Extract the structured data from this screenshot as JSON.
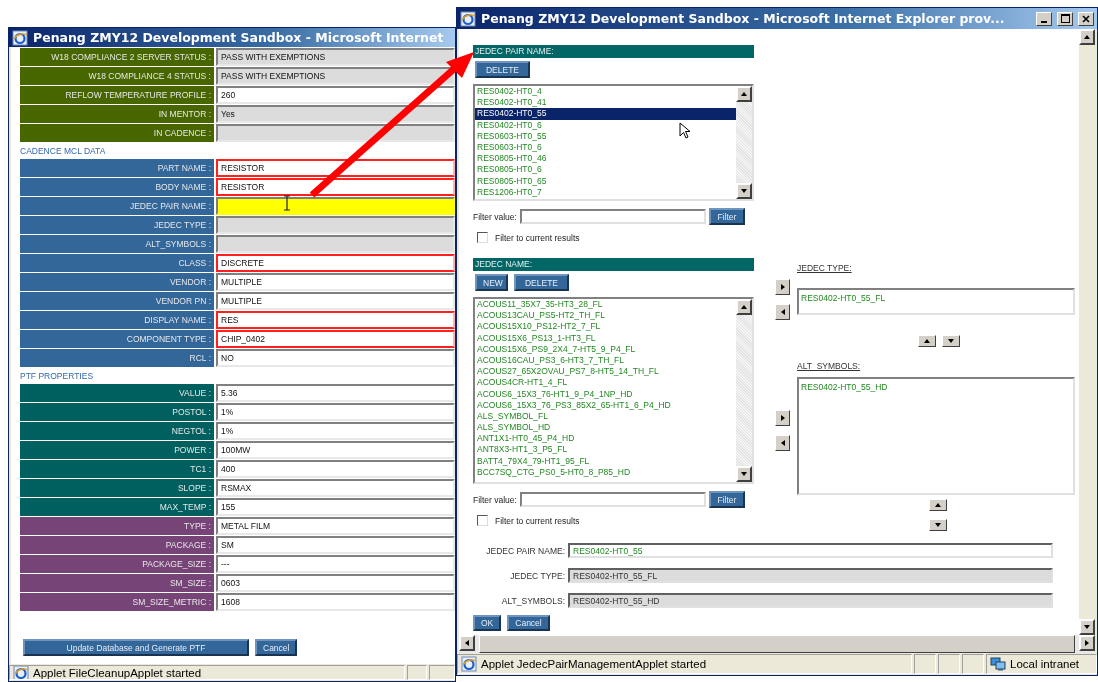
{
  "left_window": {
    "title": "Penang ZMY12 Development Sandbox - Microsoft Internet",
    "groups": [
      {
        "color": "#476600",
        "rows": [
          {
            "label": "W18 COMPLIANCE 2 SERVER STATUS :",
            "value": "PASS WITH EXEMPTIONS",
            "kind": "readonly"
          },
          {
            "label": "W18 COMPLIANCE 4 STATUS :",
            "value": "PASS WITH EXEMPTIONS",
            "kind": "readonly"
          },
          {
            "label": "REFLOW TEMPERATURE PROFILE :",
            "value": "260",
            "kind": "editable"
          },
          {
            "label": "IN MENTOR :",
            "value": "Yes",
            "kind": "readonly"
          },
          {
            "label": "IN CADENCE :",
            "kind": "readonly"
          }
        ]
      },
      {
        "section": "CADENCE MCL DATA",
        "color": "#336699",
        "rows": [
          {
            "label": "PART NAME :",
            "value": "RESISTOR",
            "kind": "required"
          },
          {
            "label": "BODY NAME :",
            "value": "RESISTOR",
            "kind": "required"
          },
          {
            "label": "JEDEC PAIR NAME :",
            "kind": "focused"
          },
          {
            "label": "JEDEC TYPE :",
            "kind": "readonly"
          },
          {
            "label": "ALT_SYMBOLS :",
            "kind": "readonly"
          },
          {
            "label": "CLASS :",
            "value": "DISCRETE",
            "kind": "required"
          },
          {
            "label": "VENDOR :",
            "value": "MULTIPLE",
            "kind": "editable"
          },
          {
            "label": "VENDOR PN :",
            "value": "MULTIPLE",
            "kind": "editable"
          },
          {
            "label": "DISPLAY NAME :",
            "value": "RES",
            "kind": "required"
          },
          {
            "label": "COMPONENT TYPE :",
            "value": "CHIP_0402",
            "kind": "required"
          },
          {
            "label": "RCL :",
            "value": "NO",
            "kind": "editable"
          }
        ]
      },
      {
        "section": "PTF PROPERTIES",
        "color": "#006060",
        "rows": [
          {
            "label": "VALUE :",
            "value": "5.36",
            "kind": "editable"
          },
          {
            "label": "POSTOL :",
            "value": "1%",
            "kind": "editable"
          },
          {
            "label": "NEGTOL :",
            "value": "1%",
            "kind": "editable"
          },
          {
            "label": "POWER :",
            "value": "100MW",
            "kind": "editable"
          },
          {
            "label": "TC1 :",
            "value": "400",
            "kind": "editable"
          },
          {
            "label": "SLOPE :",
            "value": "RSMAX",
            "kind": "editable"
          },
          {
            "label": "MAX_TEMP :",
            "value": "155",
            "kind": "editable"
          }
        ]
      },
      {
        "color": "#774477",
        "rows": [
          {
            "label": "TYPE :",
            "value": "METAL FILM",
            "kind": "editable"
          },
          {
            "label": "PACKAGE :",
            "value": "SM",
            "kind": "editable"
          },
          {
            "label": "PACKAGE_SIZE :",
            "value": "---",
            "kind": "editable"
          },
          {
            "label": "SM_SIZE :",
            "value": "0603",
            "kind": "editable"
          },
          {
            "label": "SM_SIZE_METRIC :",
            "value": "1608",
            "kind": "editable"
          }
        ]
      }
    ],
    "buttons": [
      "Update Database and Generate PTF",
      "Cancel"
    ],
    "status_bar": {
      "text": "Applet FileCleanupApplet started"
    }
  },
  "right_window": {
    "title": "Penang ZMY12 Development Sandbox - Microsoft Internet Explorer prov...",
    "pair_panel": {
      "header": "JEDEC PAIR NAME:",
      "buttons": [
        "DELETE"
      ],
      "items": [
        {
          "text": "RES0402-HT0_4",
          "selected": false
        },
        {
          "text": "RES0402-HT0_41",
          "selected": false
        },
        {
          "text": "RES0402-HT0_55",
          "selected": true
        },
        {
          "text": "RES0402-HT0_6",
          "selected": false
        },
        {
          "text": "RES0603-HT0_55",
          "selected": false
        },
        {
          "text": "RES0603-HT0_6",
          "selected": false
        },
        {
          "text": "RES0805-HT0_46",
          "selected": false
        },
        {
          "text": "RES0805-HT0_6",
          "selected": false
        },
        {
          "text": "RES0805-HT0_65",
          "selected": false
        },
        {
          "text": "RES1206-HT0_7",
          "selected": false
        }
      ],
      "filter_label": "Filter value:",
      "filter_button": "Filter",
      "filter_current": {
        "label": "Filter to current results",
        "checked": false
      }
    },
    "name_panel": {
      "header": "JEDEC NAME:",
      "buttons": [
        "NEW",
        "DELETE"
      ],
      "items": [
        {
          "text": "ACOUS11_35X7_35-HT3_28_FL",
          "selected": false
        },
        {
          "text": "ACOUS13CAU_PS5-HT2_TH_FL",
          "selected": false
        },
        {
          "text": "ACOUS15X10_PS12-HT2_7_FL",
          "selected": false
        },
        {
          "text": "ACOUS15X6_PS13_1-HT3_FL",
          "selected": false
        },
        {
          "text": "ACOUS15X6_PS9_2X4_7-HT5_9_P4_FL",
          "selected": false
        },
        {
          "text": "ACOUS16CAU_PS3_6-HT3_7_TH_FL",
          "selected": false
        },
        {
          "text": "ACOUS27_65X2OVAU_PS7_8-HT5_14_TH_FL",
          "selected": false
        },
        {
          "text": "ACOUS4CR-HT1_4_FL",
          "selected": false
        },
        {
          "text": "ACOUS6_15X3_76-HT1_9_P4_1NP_HD",
          "selected": false
        },
        {
          "text": "ACOUS6_15X3_76_PS3_85X2_65-HT1_6_P4_HD",
          "selected": false
        },
        {
          "text": "ALS_SYMBOL_FL",
          "selected": false
        },
        {
          "text": "ALS_SYMBOL_HD",
          "selected": false
        },
        {
          "text": "ANT1X1-HT0_45_P4_HD",
          "selected": false
        },
        {
          "text": "ANT8X3-HT1_3_P5_FL",
          "selected": false
        },
        {
          "text": "BATT4_79X4_79-HT1_95_FL",
          "selected": false
        },
        {
          "text": "BCC7SQ_CTG_PS0_5-HT0_8_P85_HD",
          "selected": false
        }
      ],
      "filter_label": "Filter value:",
      "filter_button": "Filter",
      "filter_current": {
        "label": "Filter to current results",
        "checked": false
      }
    },
    "jedec_type": {
      "label": "JEDEC TYPE:",
      "items": [
        "RES0402-HT0_55_FL"
      ]
    },
    "alt_symbols": {
      "label": "ALT_SYMBOLS:",
      "items": [
        "RES0402-HT0_55_HD"
      ]
    },
    "fields": [
      {
        "label": "JEDEC PAIR NAME:",
        "value": "RES0402-HT0_55",
        "readonly": false
      },
      {
        "label": "JEDEC TYPE:",
        "value": "RES0402-HT0_55_FL",
        "readonly": true
      },
      {
        "label": "ALT_SYMBOLS:",
        "value": "RES0402-HT0_55_HD",
        "readonly": true
      }
    ],
    "buttons": [
      "OK",
      "Cancel"
    ],
    "status_bar": {
      "text": "Applet JedecPairManagementApplet started",
      "zone": "Local intranet"
    }
  }
}
